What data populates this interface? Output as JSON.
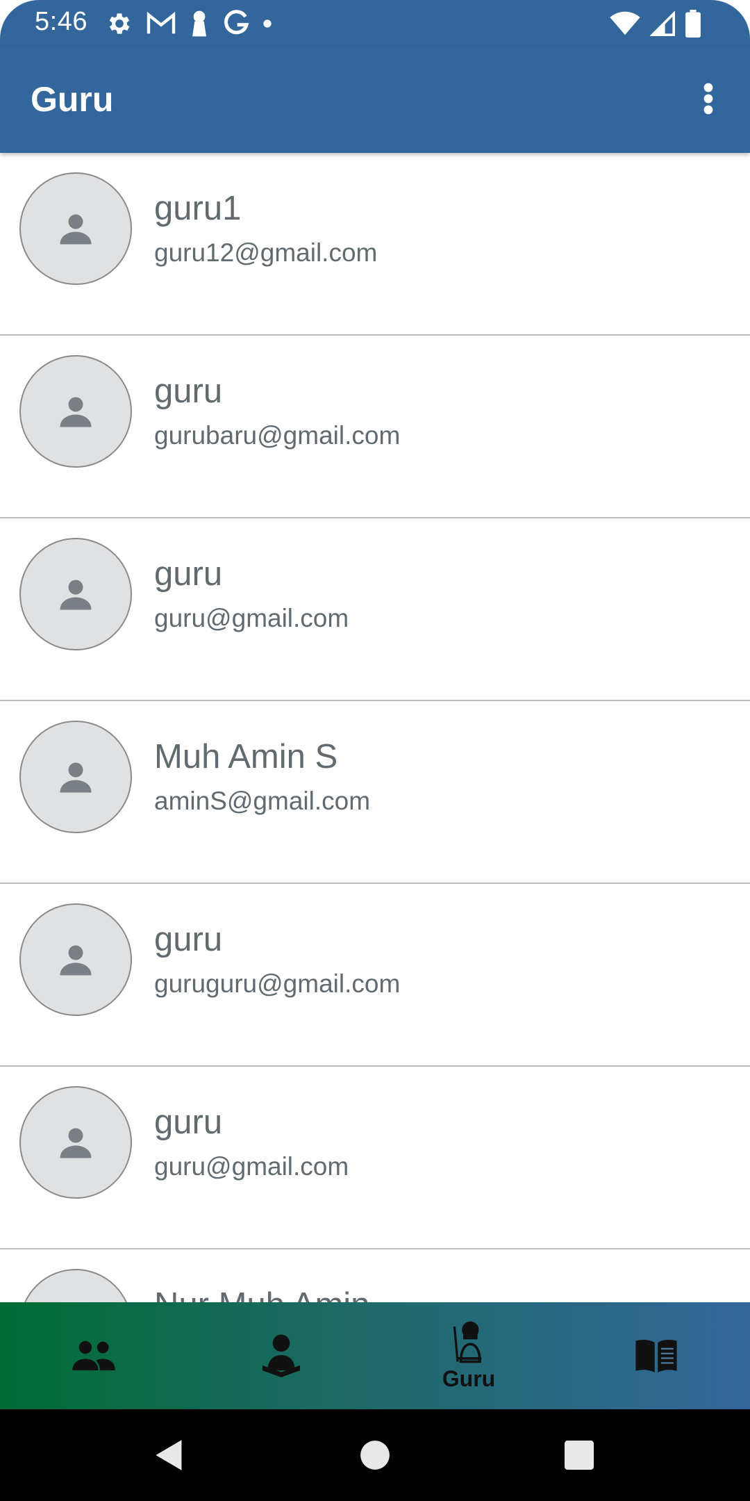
{
  "status_bar": {
    "time": "5:46",
    "icons_left": [
      "settings-icon",
      "gmail-icon",
      "keyhole-icon",
      "google-icon",
      "dot-icon"
    ],
    "icons_right": [
      "wifi-icon",
      "signal-icon",
      "battery-icon"
    ]
  },
  "app_bar": {
    "title": "Guru",
    "menu_icon": "more-vert-icon"
  },
  "list": {
    "items": [
      {
        "name": "guru1",
        "email": "guru12@gmail.com"
      },
      {
        "name": "guru",
        "email": "gurubaru@gmail.com"
      },
      {
        "name": "guru",
        "email": "guru@gmail.com"
      },
      {
        "name": "Muh Amin S",
        "email": "aminS@gmail.com"
      },
      {
        "name": "guru",
        "email": "guruguru@gmail.com"
      },
      {
        "name": "guru",
        "email": "guru@gmail.com"
      },
      {
        "name": "Nur Muh Amin",
        "email": ""
      }
    ]
  },
  "bottom_nav": {
    "items": [
      {
        "icon": "group-icon",
        "label": ""
      },
      {
        "icon": "student-reading-icon",
        "label": ""
      },
      {
        "icon": "teacher-icon",
        "label": "Guru",
        "active": true
      },
      {
        "icon": "book-icon",
        "label": ""
      }
    ]
  },
  "system_nav": {
    "buttons": [
      "back-icon",
      "home-icon",
      "recents-icon"
    ]
  },
  "colors": {
    "primary": "#33679b",
    "nav_gradient_start": "#006b35",
    "nav_gradient_end": "#33679b",
    "text_secondary": "#616a6e",
    "avatar_bg": "#e0e1e3",
    "avatar_icon": "#7a7f85"
  }
}
